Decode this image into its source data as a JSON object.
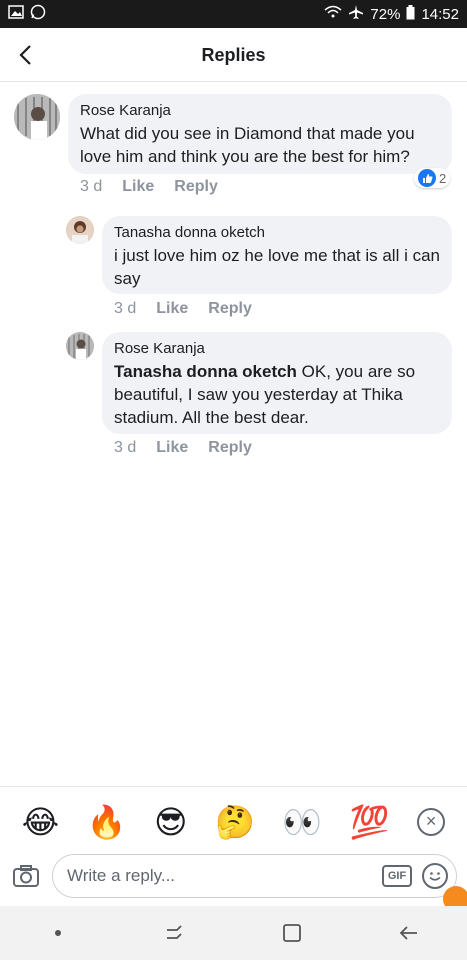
{
  "status_bar": {
    "battery": "72%",
    "time": "14:52"
  },
  "header": {
    "title": "Replies"
  },
  "comments": [
    {
      "author": "Rose Karanja",
      "text": "What did you see in Diamond that made you love him and think you are the best for him?",
      "time": "3 d",
      "like_label": "Like",
      "reply_label": "Reply",
      "reaction_count": "2"
    },
    {
      "author": "Tanasha donna oketch",
      "text": "i just love him oz he love me that is all i can say",
      "time": "3 d",
      "like_label": "Like",
      "reply_label": "Reply"
    },
    {
      "author": "Rose Karanja",
      "mention": "Tanasha donna oketch",
      "text": " OK, you are so beautiful, I saw you yesterday at Thika stadium. All the best dear.",
      "time": "3 d",
      "like_label": "Like",
      "reply_label": "Reply"
    }
  ],
  "emoji_bar": {
    "emojis": [
      "😂",
      "🔥",
      "😎",
      "🤔",
      "👀",
      "💯"
    ],
    "icons": [
      "laughing-emoji",
      "fire-emoji",
      "sunglasses-emoji",
      "thinking-emoji",
      "eyes-emoji",
      "hundred-emoji"
    ]
  },
  "reply_input": {
    "placeholder": "Write a reply...",
    "gif_label": "GIF"
  },
  "colors": {
    "accent": "#1877f2",
    "bubble": "#f0f2f5",
    "meta_text": "#8d949e"
  }
}
